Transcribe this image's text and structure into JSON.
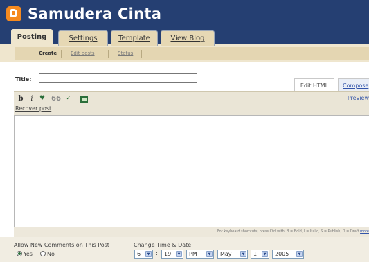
{
  "header": {
    "blog_title": "Samudera Cinta"
  },
  "tabs": [
    {
      "label": "Posting",
      "active": true
    },
    {
      "label": "Settings"
    },
    {
      "label": "Template"
    },
    {
      "label": "View Blog"
    }
  ],
  "subnav": [
    {
      "label": "Create",
      "active": true
    },
    {
      "label": "Edit posts"
    },
    {
      "label": "Status"
    }
  ],
  "post": {
    "title_label": "Title:",
    "title_value": ""
  },
  "editor_tabs": {
    "edit_html": "Edit HTML",
    "compose": "Compose"
  },
  "toolbar": {
    "bold": "b",
    "italic": "i",
    "quote": "66",
    "recover_post": "Recover post",
    "preview": "Preview"
  },
  "shortcut_hint": {
    "text": "For keyboard shortcuts, press Ctrl with: B = Bold, I = Italic, S = Publish, D = Draft",
    "more": "more"
  },
  "comments": {
    "label": "Allow New Comments on This Post",
    "yes": "Yes",
    "no": "No",
    "selected": "Yes"
  },
  "datetime": {
    "label": "Change Time & Date",
    "hour": "6",
    "colon": ":",
    "minute": "19",
    "ampm": "PM",
    "month": "May",
    "day": "1",
    "year": "2005"
  },
  "icons": [
    "logo-icon",
    "link-icon",
    "quote-icon",
    "spellcheck-icon",
    "image-icon",
    "dropdown-arrow-icon",
    "radio-icon"
  ],
  "colors": {
    "header_bg": "#253f72",
    "logo": "#f58a1f",
    "tab_active": "#efe6ce",
    "toolbar_bg": "#eae5d6"
  }
}
